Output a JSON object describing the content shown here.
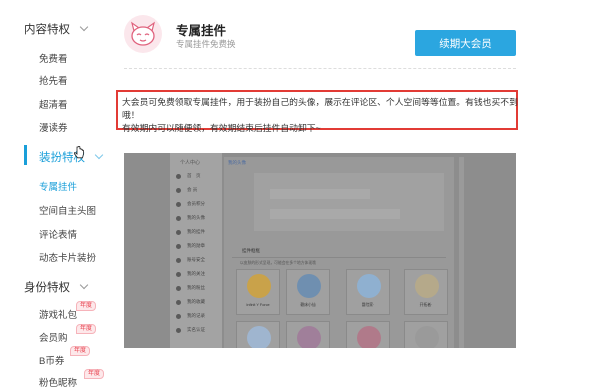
{
  "sidebar": {
    "sections": [
      {
        "label": "内容特权",
        "items": [
          "免费看",
          "抢先看",
          "超清看",
          "漫读券"
        ]
      },
      {
        "label": "装扮特权",
        "items": [
          "专属挂件",
          "空间自主头图",
          "评论表情",
          "动态卡片装扮"
        ]
      },
      {
        "label": "身份特权",
        "items": [
          "游戏礼包",
          "会员购",
          "B币券",
          "粉色昵称"
        ]
      }
    ],
    "badge_text": "年度",
    "accent_color": "#1a9fd9"
  },
  "header": {
    "avatar_icon": "pink-mascot-icon",
    "title": "专属挂件",
    "subtitle": "专属挂件免费换",
    "renew_label": "续期大会员"
  },
  "notes": {
    "highlighted_line1": "大会员可免费领取专属挂件，用于装扮自己的头像，展示在评论区、个人空间等等位置。有钱也买不到",
    "highlighted_line2": "哦！",
    "line3": "有效期内可以随便领，有效期结束后挂件自动卸下~"
  },
  "preview": {
    "sidebar_title": "个人中心",
    "sidebar_items": [
      "首　页",
      "会 员",
      "会员积分",
      "我的头像",
      "我的挂件",
      "我的勋章",
      "账号安全",
      "我的关注",
      "我的粉丝",
      "我的收藏",
      "我的记录",
      "实名认证"
    ],
    "content_tab": "我的头像",
    "pendant_heading": "挂件框框",
    "pendant_sub": "以皮肤的形式呈现，可能会在多个地方体现哦",
    "cards": [
      "Infinit Y Force",
      "赖床小仙",
      "冒险家·",
      "开拓者·"
    ]
  }
}
